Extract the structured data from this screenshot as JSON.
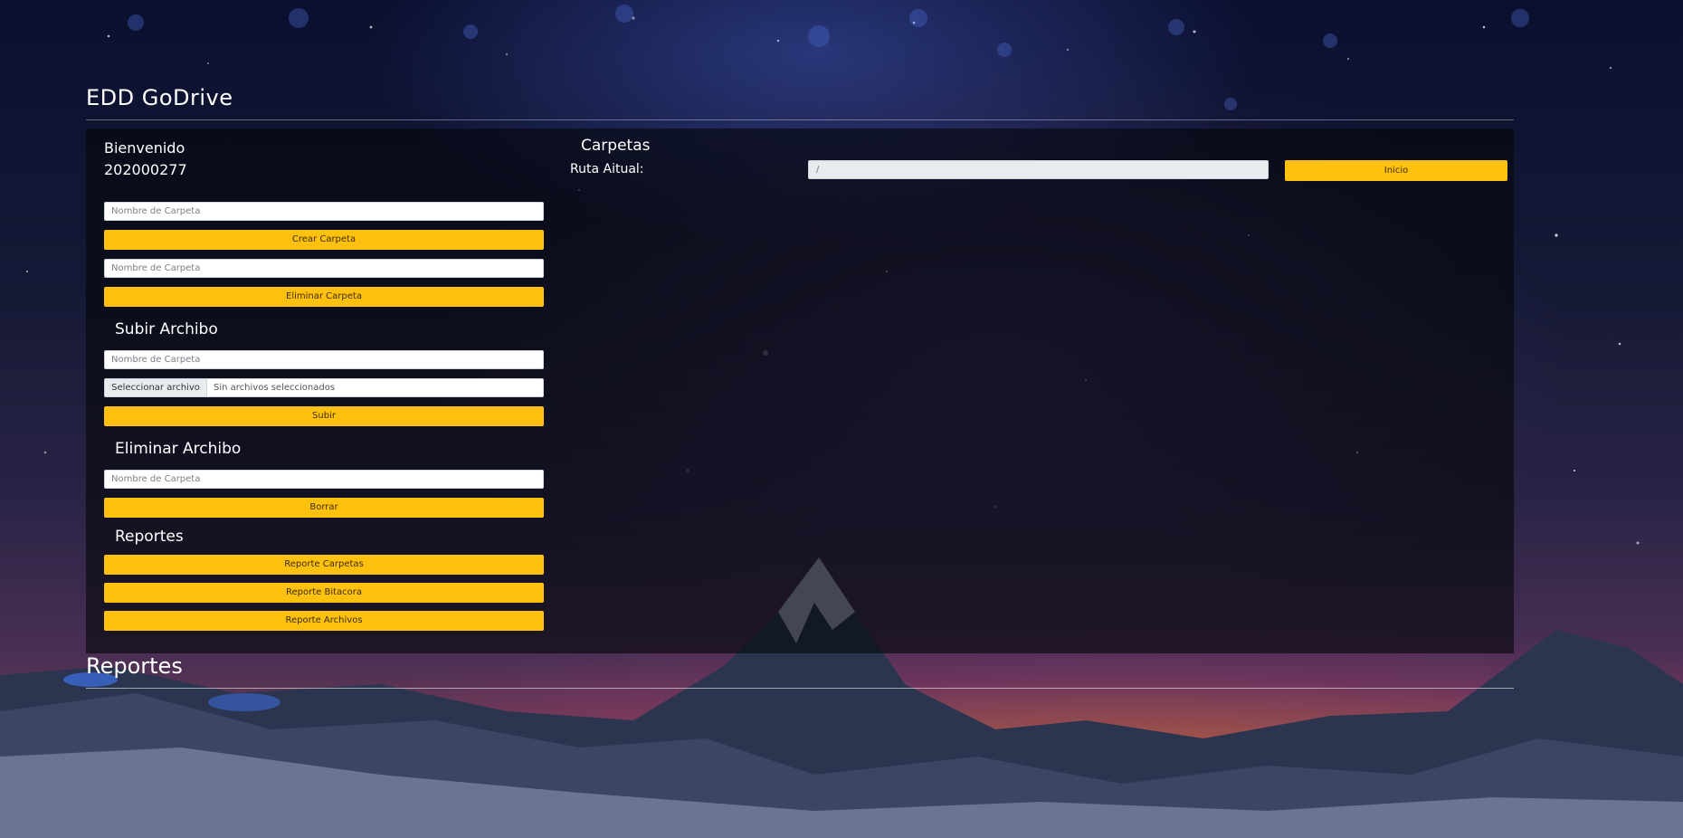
{
  "header": {
    "title": "EDD GoDrive"
  },
  "user": {
    "welcome": "Bienvenido",
    "id": "202000277"
  },
  "folders": {
    "create_placeholder": "Nombre de Carpeta",
    "create_button": "Crear Carpeta",
    "delete_placeholder": "Nombre de Carpeta",
    "delete_button": "Eliminar Carpeta"
  },
  "upload": {
    "title": "Subir Archibo",
    "folder_placeholder": "Nombre de Carpeta",
    "file_button": "Seleccionar archivo",
    "file_status": "Sin archivos seleccionados",
    "submit_button": "Subir"
  },
  "delete_file": {
    "title": "Eliminar Archibo",
    "folder_placeholder": "Nombre de Carpeta",
    "submit_button": "Borrar"
  },
  "reports": {
    "title": "Reportes",
    "buttons": [
      "Reporte Carpetas",
      "Reporte Bitacora",
      "Reporte Archivos"
    ]
  },
  "browser": {
    "title": "Carpetas",
    "path_label": "Ruta Aitual:",
    "path_value": "/",
    "home_button": "Inicio"
  },
  "footer_section": {
    "title": "Reportes"
  },
  "colors": {
    "accent": "#ffc10f",
    "panel": "rgba(5,6,12,0.62)"
  }
}
